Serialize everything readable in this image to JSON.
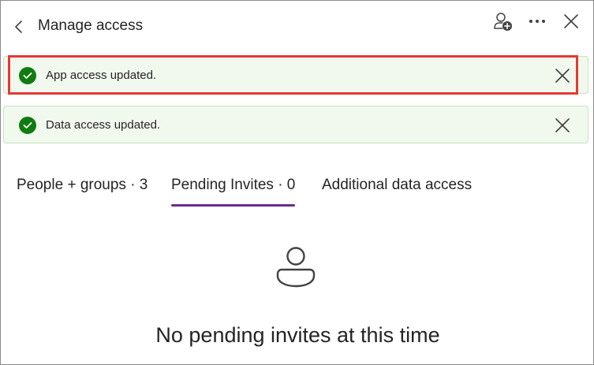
{
  "header": {
    "title": "Manage access"
  },
  "banners": [
    {
      "text": "App access updated."
    },
    {
      "text": "Data access updated."
    }
  ],
  "tabs": [
    {
      "label": "People + groups · 3"
    },
    {
      "label": "Pending Invites · 0",
      "selected": true
    },
    {
      "label": "Additional data access"
    }
  ],
  "empty_state": {
    "message": "No pending invites at this time"
  },
  "colors": {
    "success_green": "#107c10",
    "banner_bg": "#f1f8ee",
    "tab_accent": "#6b2c91",
    "highlight_red": "#e53935"
  },
  "icons": {
    "back": "chevron-left-icon",
    "add_person": "person-add-icon",
    "more": "more-horizontal-icon",
    "close": "close-icon",
    "success": "checkmark-circle-icon",
    "empty": "person-icon"
  }
}
